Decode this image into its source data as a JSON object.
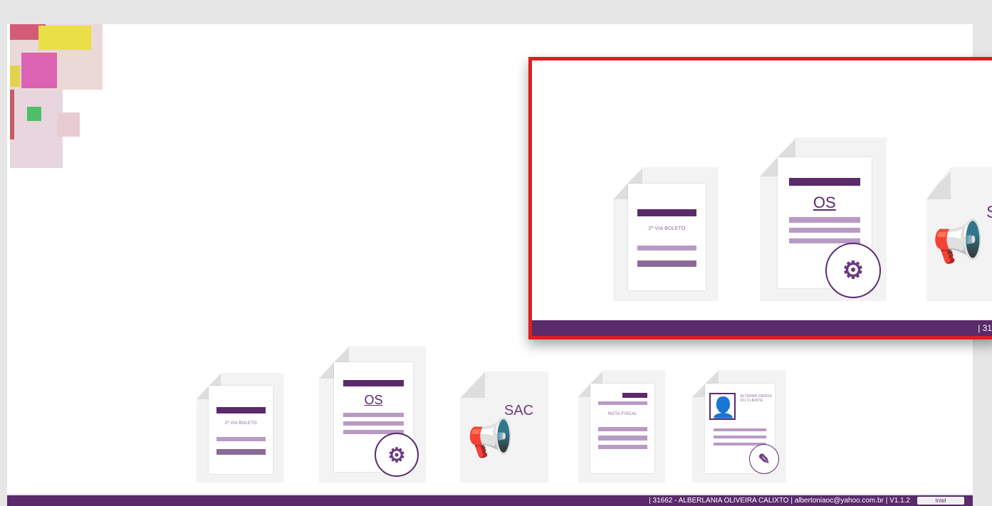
{
  "footer": {
    "info": "| 31662 - ALBERLANIA OLIVEIRA CALIXTO | albertoniaoc@yahoo.com.br | V1.1.2",
    "badge": "Intel"
  },
  "icons": [
    {
      "id": "segunda-via-boleto",
      "label": "2ª VIA BOLETO"
    },
    {
      "id": "os",
      "label": "OS"
    },
    {
      "id": "sac",
      "label": "SAC"
    },
    {
      "id": "nota-fiscal",
      "label": "NOTA FISCAL"
    },
    {
      "id": "alterar-dados",
      "label": "ALTERAR DADOS DO CLIENTE"
    }
  ],
  "zoom": {
    "boleto_label": "2ª VIA BOLETO",
    "os_label": "OS",
    "sac_label": "S",
    "footer_text": "| 31"
  },
  "colors": {
    "brand_purple": "#5a2a6b",
    "accent_lilac": "#b99ac4",
    "zoom_border": "#d92020"
  }
}
